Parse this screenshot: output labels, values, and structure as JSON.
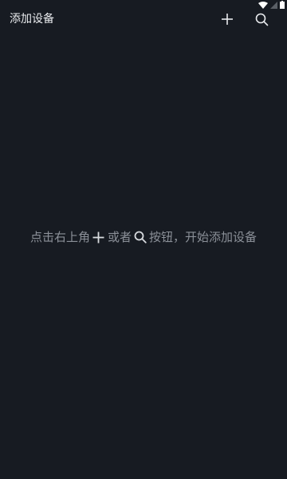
{
  "header": {
    "title": "添加设备",
    "add_icon": "plus-icon",
    "search_icon": "search-icon"
  },
  "status_bar": {
    "icons": [
      "wifi-icon",
      "signal-icon",
      "battery-icon"
    ]
  },
  "empty_state": {
    "text_part1": "点击右上角",
    "text_part2": "或者",
    "text_part3": "按钮，开始添加设备"
  },
  "colors": {
    "background": "#171b22",
    "title_text": "#e9ebee",
    "hint_text": "#8b9098",
    "icon": "#e9ebee"
  }
}
